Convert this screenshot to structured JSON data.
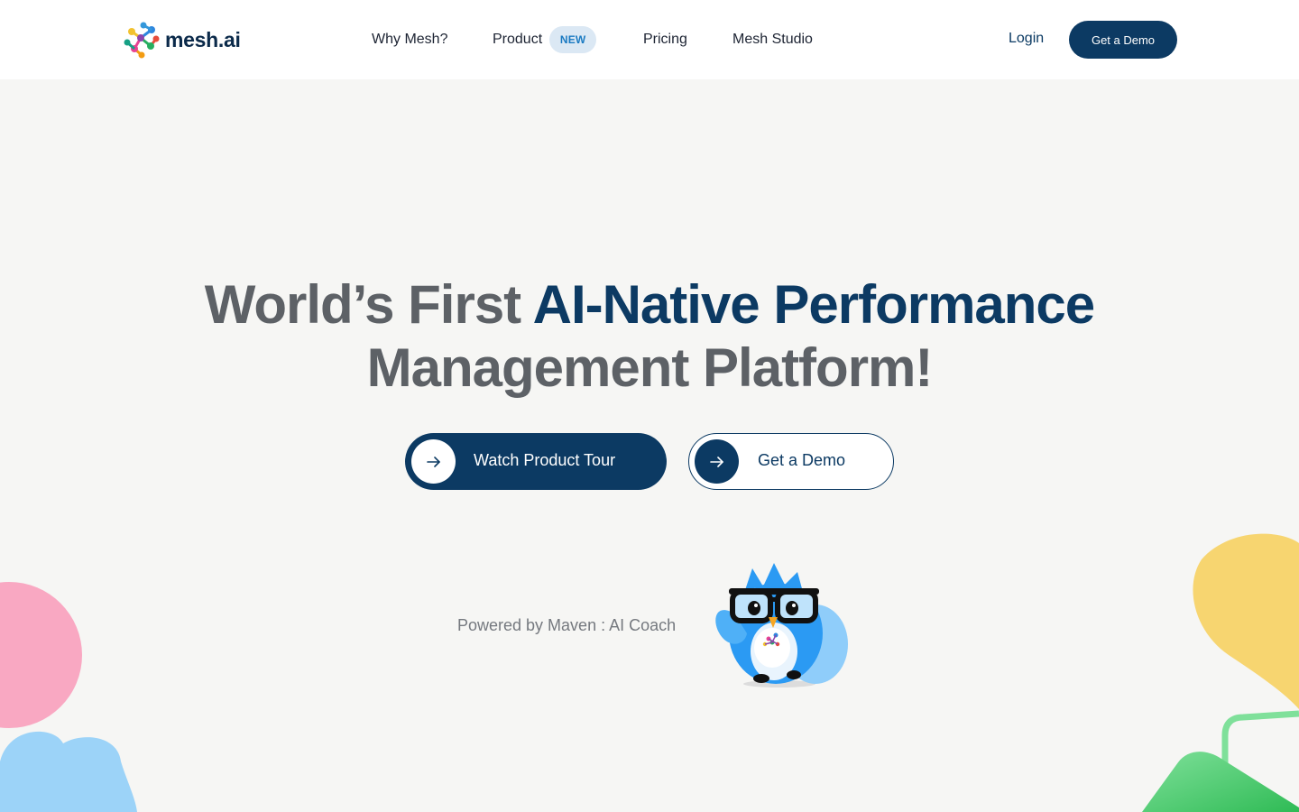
{
  "brand": {
    "name": "mesh.ai"
  },
  "nav": {
    "items": [
      {
        "label": "Why Mesh?"
      },
      {
        "label": "Product",
        "badge": "NEW"
      },
      {
        "label": "Pricing"
      },
      {
        "label": "Mesh Studio"
      }
    ]
  },
  "header": {
    "login_label": "Login",
    "demo_label": "Get a Demo"
  },
  "hero": {
    "title_part1": "World’s First ",
    "title_accent": "AI-Native Performance",
    "title_part2": "Management Platform!",
    "primary_button": "Watch Product Tour",
    "secondary_button": "Get a Demo",
    "powered_by": "Powered by Maven : AI Coach"
  },
  "icons": {
    "button_arrow": "arrow-right-icon",
    "mascot": "owl-mascot-icon",
    "logo": "mesh-logo-icon"
  },
  "colors": {
    "primary": "#0c3a63",
    "badge_bg": "#dbe8f4",
    "badge_text": "#1a7ac2",
    "background": "#f6f6f4",
    "blob_pink": "#f9a8c2",
    "blob_blue": "#9cd3f8",
    "blob_yellow": "#f7d570",
    "blob_green": "#46c86a"
  }
}
